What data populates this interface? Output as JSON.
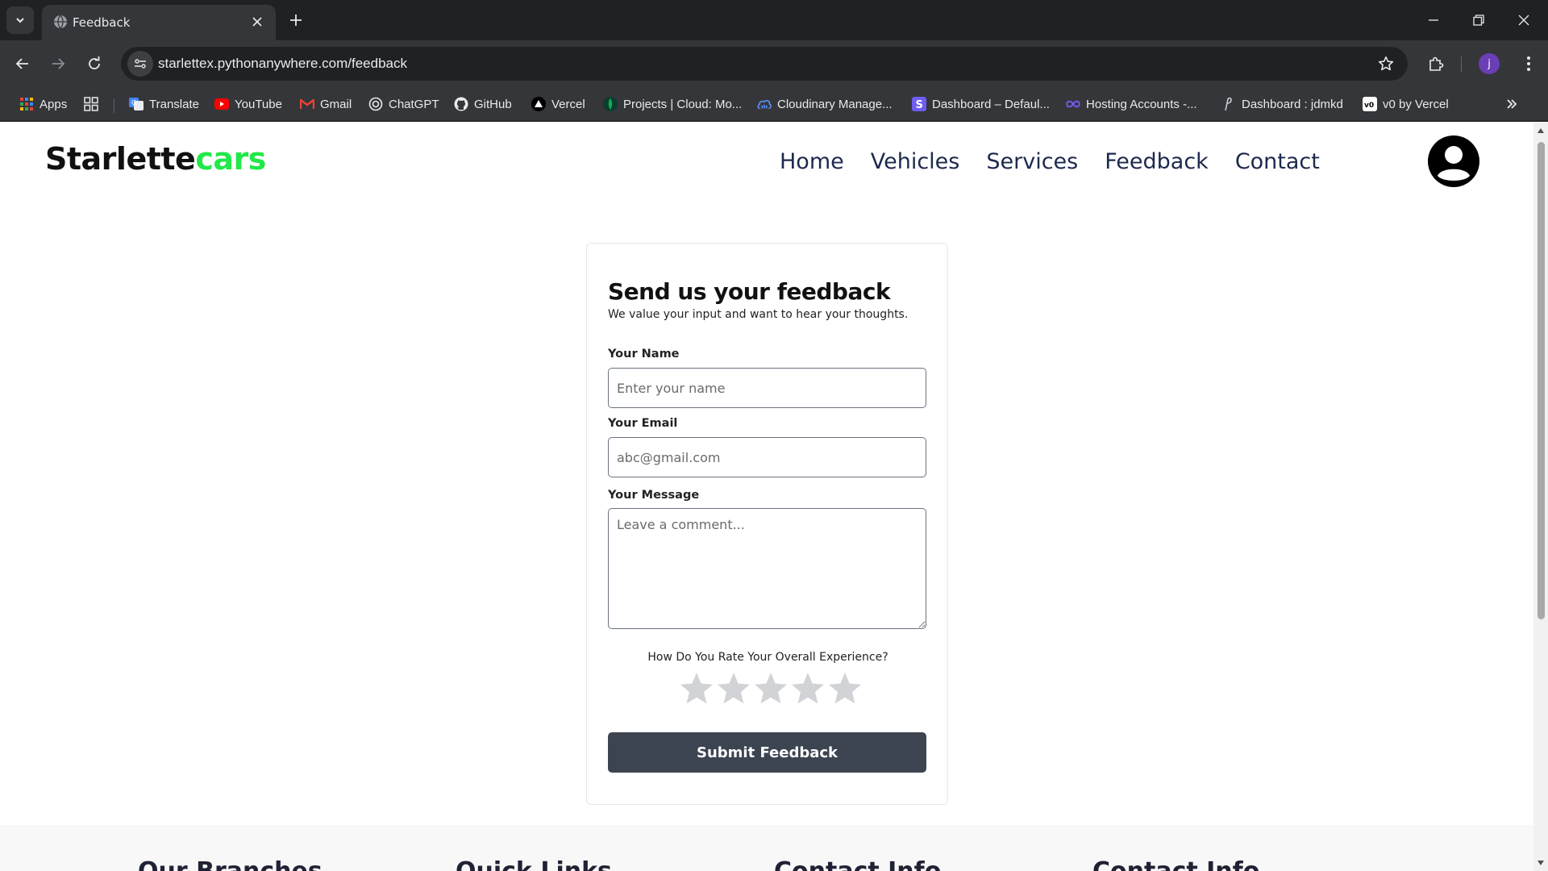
{
  "browser": {
    "tab_title": "Feedback",
    "url": "starlettex.pythonanywhere.com/feedback",
    "profile_initial": "j",
    "bookmarks": [
      {
        "label": "Apps",
        "icon": "apps-grid-icon"
      },
      {
        "label": "",
        "icon": "tab-groups-icon"
      },
      {
        "label": "Translate",
        "icon": "translate-icon"
      },
      {
        "label": "YouTube",
        "icon": "youtube-icon"
      },
      {
        "label": "Gmail",
        "icon": "gmail-icon"
      },
      {
        "label": "ChatGPT",
        "icon": "chatgpt-icon"
      },
      {
        "label": "GitHub",
        "icon": "github-icon"
      },
      {
        "label": "Vercel",
        "icon": "vercel-icon"
      },
      {
        "label": "Projects | Cloud: Mo...",
        "icon": "mongodb-icon"
      },
      {
        "label": "Cloudinary Manage...",
        "icon": "cloudinary-icon"
      },
      {
        "label": "Dashboard – Defaul...",
        "icon": "stackbit-icon"
      },
      {
        "label": "Hosting Accounts -...",
        "icon": "infinity-icon"
      },
      {
        "label": "Dashboard : jdmkd",
        "icon": "pythonanywhere-icon"
      },
      {
        "label": "v0 by Vercel",
        "icon": "v0-icon"
      }
    ]
  },
  "site": {
    "logo_main": "Starlette",
    "logo_accent": "cars",
    "nav": [
      "Home",
      "Vehicles",
      "Services",
      "Feedback",
      "Contact"
    ],
    "accent_color": "#22e84a"
  },
  "form": {
    "title": "Send us your feedback",
    "subtitle": "We value your input and want to hear your thoughts.",
    "name_label": "Your Name",
    "name_placeholder": "Enter your name",
    "email_label": "Your Email",
    "email_placeholder": "abc@gmail.com",
    "message_label": "Your Message",
    "message_placeholder": "Leave a comment...",
    "rating_question": "How Do You Rate Your Overall Experience?",
    "rating": 0,
    "rating_max": 5,
    "submit_label": "Submit Feedback"
  },
  "footer": {
    "headings": [
      "Our Branches",
      "Quick Links",
      "Contact Info",
      "Contact Info"
    ]
  }
}
